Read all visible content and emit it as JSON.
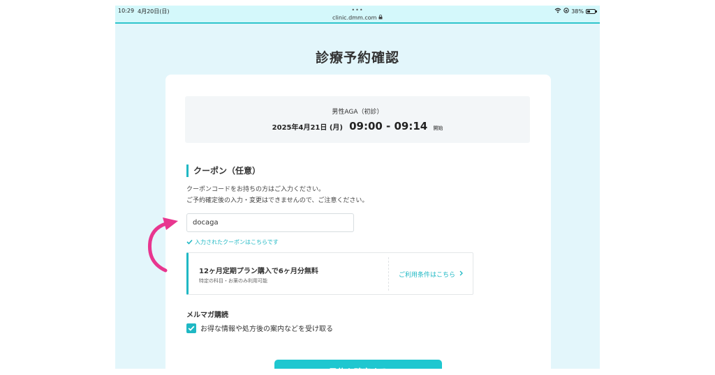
{
  "status_bar": {
    "time": "10:29",
    "date": "4月20日(日)",
    "dots": "•••",
    "url": "clinic.dmm.com",
    "battery": "38%",
    "battery_level": 0.38
  },
  "page": {
    "title": "診療予約確認"
  },
  "reservation": {
    "menu": "男性AGA（初診）",
    "date": "2025年4月21日 (月)",
    "time": "09:00 - 09:14",
    "start_label": "開始"
  },
  "coupon": {
    "heading": "クーポン（任意）",
    "desc_line1": "クーポンコードをお持ちの方はご入力ください。",
    "desc_line2": "ご予約確定後の入力・変更はできませんので、ご注意ください。",
    "input_value": "docaga",
    "valid_message": "入力されたクーポンはこちらです",
    "offer_title": "12ヶ月定期プラン購入で6ヶ月分無料",
    "offer_sub": "特定の科目・お薬のみ利用可能",
    "terms_link": "ご利用条件はこちら"
  },
  "newsletter": {
    "heading": "メルマガ購読",
    "checkbox_label": "お得な情報や処方後の案内などを受け取る",
    "checked": true
  },
  "confirm_button": {
    "label": "予約を確定する"
  },
  "colors": {
    "accent": "#1fb8c4",
    "page_bg": "#e3f6fb",
    "annotation_arrow": "#e8368f"
  }
}
